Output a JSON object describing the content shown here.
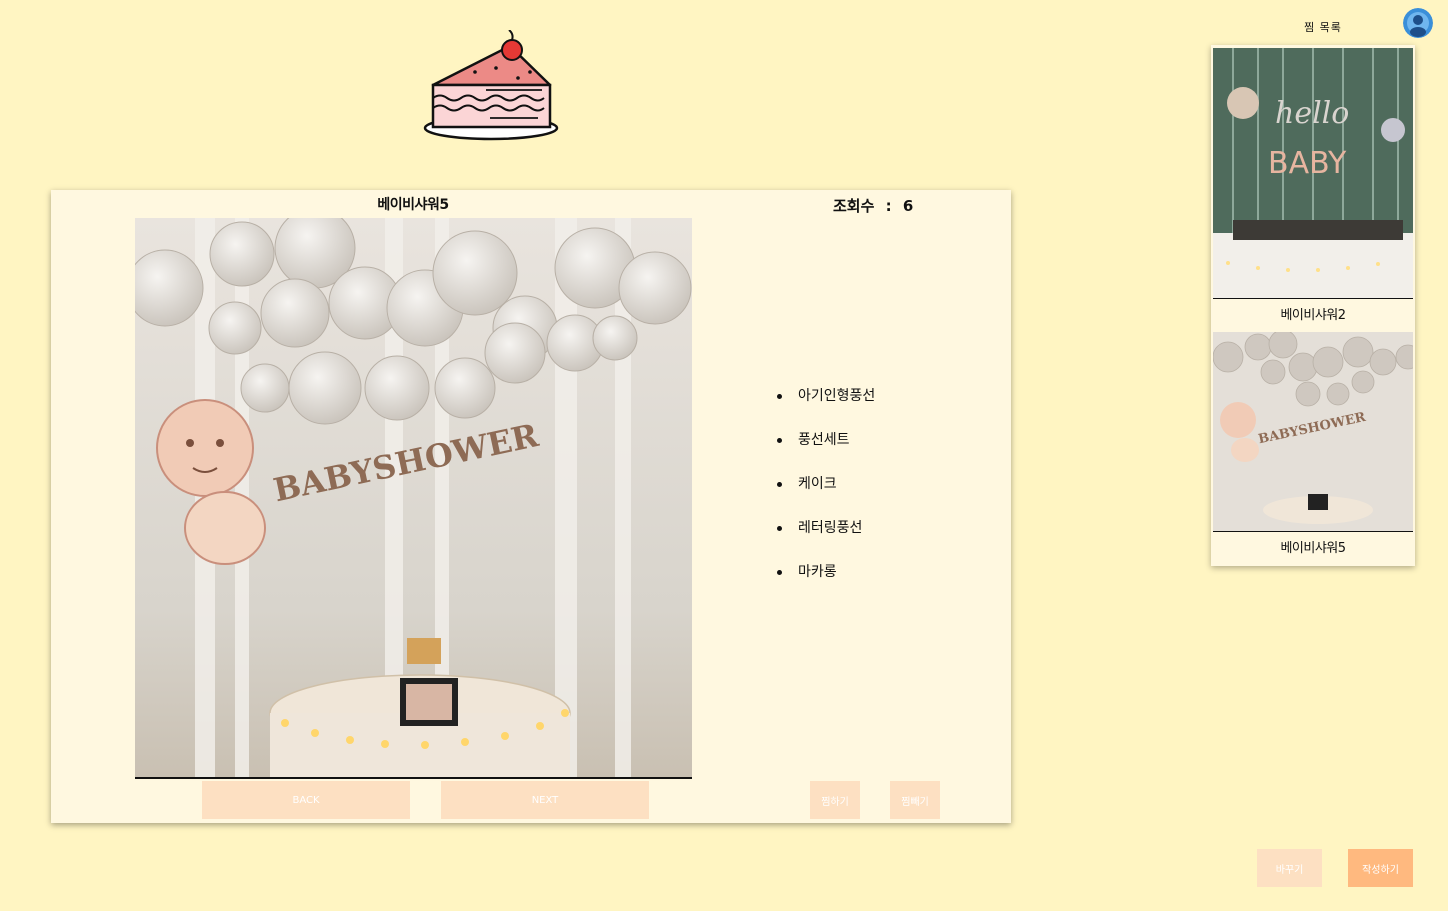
{
  "logo": {
    "icon": "cake-slice-icon"
  },
  "post": {
    "title": "베이비샤워5",
    "views_label": "조회수",
    "views_separator": ":",
    "views_count": "6",
    "photo_banner_text": "BABYSHOWER",
    "items": [
      "아기인형풍선",
      "풍선세트",
      "케이크",
      "레터링풍선",
      "마카롱"
    ],
    "back_label": "BACK",
    "next_label": "NEXT",
    "like_label": "찜하기",
    "unlike_label": "찜빼기"
  },
  "wishlist": {
    "title": "찜 목록",
    "avatar_icon": "user-avatar-icon",
    "items": [
      {
        "caption": "베이비샤워2",
        "photo_text_1": "hello",
        "photo_text_2": "BABY"
      },
      {
        "caption": "베이비샤워5",
        "photo_text_1": "BABYSHOWER"
      }
    ]
  },
  "footer": {
    "edit_label": "바꾸기",
    "write_label": "작성하기"
  },
  "colors": {
    "background": "#fff5c2",
    "card": "#fff8e0",
    "button_light": "#fde0c2",
    "button_accent": "#ffb97f"
  }
}
